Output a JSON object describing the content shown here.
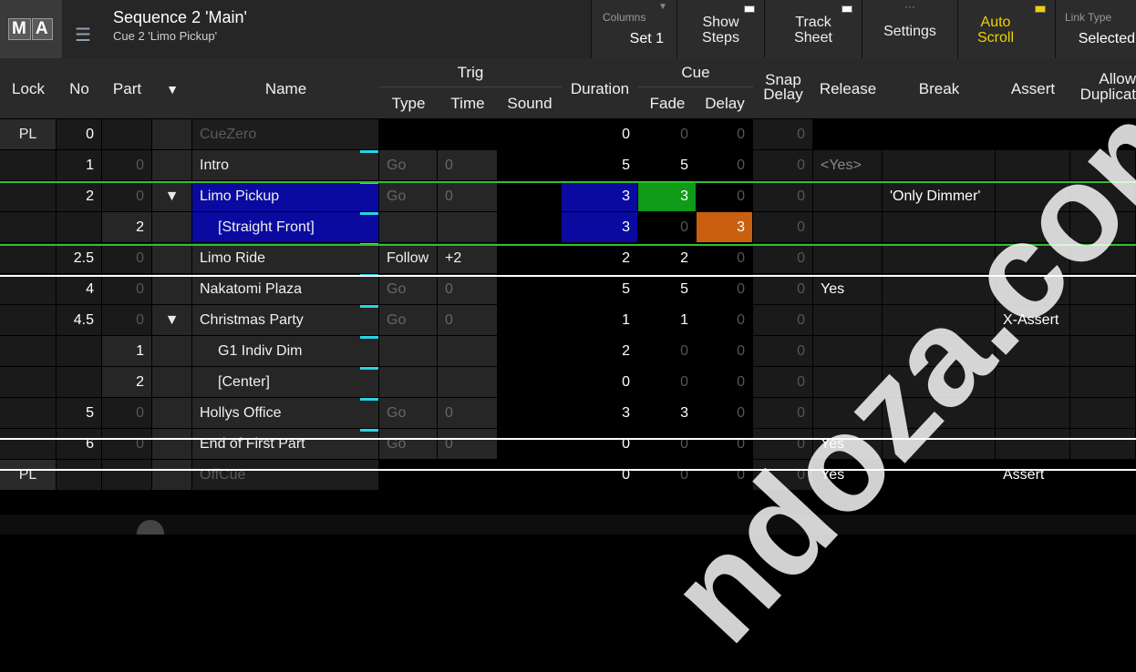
{
  "app": {
    "logo": [
      "M",
      "A"
    ],
    "menu_icon": "list-icon"
  },
  "sequence": {
    "title": "Sequence 2 'Main'",
    "subtitle": "Cue 2 'Limo Pickup'"
  },
  "toolbar": {
    "columns_label": "Columns",
    "columns_value": "Set 1",
    "show_steps": [
      "Show",
      "Steps"
    ],
    "track_sheet": [
      "Track",
      "Sheet"
    ],
    "settings": "Settings",
    "auto_scroll": [
      "Auto",
      "Scroll"
    ],
    "link_type_label": "Link Type",
    "link_type_value": "Selected"
  },
  "headers": {
    "lock": "Lock",
    "no": "No",
    "part": "Part",
    "expand": "▼",
    "name": "Name",
    "trig": "Trig",
    "type": "Type",
    "time": "Time",
    "sound": "Sound",
    "duration": "Duration",
    "cue": "Cue",
    "fade": "Fade",
    "delay": "Delay",
    "snap_delay": [
      "Snap",
      "Delay"
    ],
    "release": "Release",
    "break": "Break",
    "assert": "Assert",
    "allow_duplicate": [
      "Allow",
      "Duplicat"
    ]
  },
  "rows": [
    {
      "lock": "PL",
      "no": "0",
      "part": "",
      "exp": "",
      "name": "CueZero",
      "type": "",
      "time": "",
      "dur": "0",
      "fade": "0",
      "delay": "0",
      "snap": "0",
      "release": "",
      "break": "",
      "assert": ""
    },
    {
      "lock": "",
      "no": "1",
      "part": "0",
      "exp": "",
      "name": "Intro",
      "type": "Go",
      "time": "0",
      "dur": "5",
      "fade": "5",
      "delay": "0",
      "snap": "0",
      "release": "<Yes>",
      "break": "",
      "assert": ""
    },
    {
      "lock": "",
      "no": "2",
      "part": "0",
      "exp": "▼",
      "name": "Limo Pickup",
      "type": "Go",
      "time": "0",
      "dur": "3",
      "fade": "3",
      "delay": "0",
      "snap": "0",
      "release": "",
      "break": "'Only Dimmer'",
      "assert": ""
    },
    {
      "lock": "",
      "no": "",
      "part": "2",
      "exp": "",
      "name": "[Straight Front]",
      "type": "",
      "time": "",
      "dur": "3",
      "fade": "0",
      "delay": "3",
      "snap": "0",
      "release": "",
      "break": "",
      "assert": ""
    },
    {
      "lock": "",
      "no": "2.5",
      "part": "0",
      "exp": "",
      "name": "Limo Ride",
      "type": "Follow",
      "time": "+2",
      "dur": "2",
      "fade": "2",
      "delay": "0",
      "snap": "0",
      "release": "",
      "break": "",
      "assert": ""
    },
    {
      "lock": "",
      "no": "4",
      "part": "0",
      "exp": "",
      "name": "Nakatomi Plaza",
      "type": "Go",
      "time": "0",
      "dur": "5",
      "fade": "5",
      "delay": "0",
      "snap": "0",
      "release": "Yes",
      "break": "",
      "assert": ""
    },
    {
      "lock": "",
      "no": "4.5",
      "part": "0",
      "exp": "▼",
      "name": "Christmas Party",
      "type": "Go",
      "time": "0",
      "dur": "1",
      "fade": "1",
      "delay": "0",
      "snap": "0",
      "release": "",
      "break": "",
      "assert": "X-Assert"
    },
    {
      "lock": "",
      "no": "",
      "part": "1",
      "exp": "",
      "name": "G1 Indiv Dim",
      "type": "",
      "time": "",
      "dur": "2",
      "fade": "0",
      "delay": "0",
      "snap": "0",
      "release": "",
      "break": "",
      "assert": ""
    },
    {
      "lock": "",
      "no": "",
      "part": "2",
      "exp": "",
      "name": "[Center]",
      "type": "",
      "time": "",
      "dur": "0",
      "fade": "0",
      "delay": "0",
      "snap": "0",
      "release": "",
      "break": "",
      "assert": ""
    },
    {
      "lock": "",
      "no": "5",
      "part": "0",
      "exp": "",
      "name": "Hollys Office",
      "type": "Go",
      "time": "0",
      "dur": "3",
      "fade": "3",
      "delay": "0",
      "snap": "0",
      "release": "",
      "break": "",
      "assert": ""
    },
    {
      "lock": "",
      "no": "6",
      "part": "0",
      "exp": "",
      "name": "End of First Part",
      "type": "Go",
      "time": "0",
      "dur": "0",
      "fade": "0",
      "delay": "0",
      "snap": "0",
      "release": "Yes",
      "break": "",
      "assert": ""
    },
    {
      "lock": "PL",
      "no": "",
      "part": "",
      "exp": "",
      "name": "OffCue",
      "type": "",
      "time": "",
      "dur": "0",
      "fade": "0",
      "delay": "0",
      "snap": "0",
      "release": "Yes",
      "break": "",
      "assert": "Assert"
    }
  ],
  "watermark": "ndoza.com",
  "colors": {
    "selected_blue": "#0a0aa0",
    "fade_green": "#0f9a18",
    "delay_orange": "#c86010",
    "line_green": "#2fbf2f",
    "cyan": "#29d3e3"
  }
}
